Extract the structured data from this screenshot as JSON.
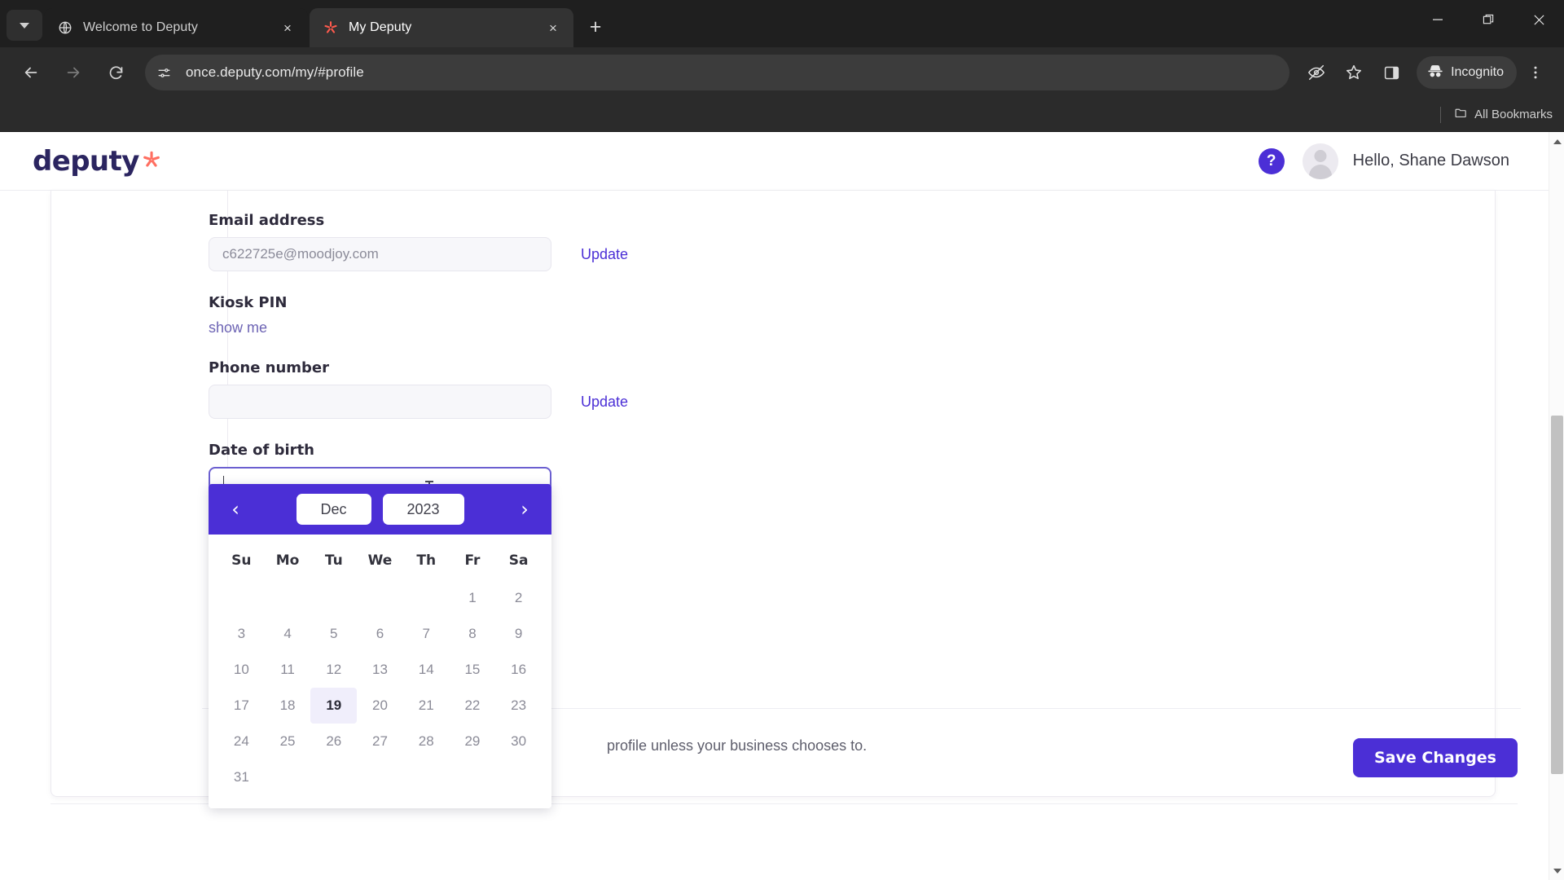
{
  "browser": {
    "tab_search_icon": "chevron-down-icon",
    "tabs": [
      {
        "title": "Welcome to Deputy",
        "favicon": "globe-icon",
        "active": false,
        "close_label": "×"
      },
      {
        "title": "My Deputy",
        "favicon": "deputy-star-icon",
        "active": true,
        "close_label": "×"
      }
    ],
    "new_tab_label": "+",
    "window_controls": {
      "minimize": "–",
      "maximize": "❐",
      "close": "✕"
    },
    "nav": {
      "back": "←",
      "forward": "→",
      "reload": "⟳"
    },
    "omnibox": {
      "url": "once.deputy.com/my/#profile",
      "site_icon": "site-settings-icon"
    },
    "toolbar_icons": [
      "eye-off-icon",
      "star-icon",
      "side-panel-icon",
      "more-vertical-icon"
    ],
    "incognito": {
      "label": "Incognito",
      "icon": "incognito-hat-icon"
    },
    "bookmarks_bar": {
      "all_bookmarks_label": "All Bookmarks",
      "folder_icon": "folder-icon"
    }
  },
  "app": {
    "logo": {
      "text": "deputy",
      "mark": "✳",
      "text_color": "#2b2560",
      "mark_color": "#ff6f61"
    },
    "help_badge": "?",
    "greeting": "Hello, Shane Dawson",
    "avatar_icon": "user-avatar-icon"
  },
  "profile_form": {
    "email": {
      "label": "Email address",
      "value": "c622725e@moodjoy.com",
      "update_label": "Update"
    },
    "kiosk_pin": {
      "label": "Kiosk PIN",
      "show_link": "show me"
    },
    "phone": {
      "label": "Phone number",
      "value": "",
      "placeholder": "",
      "update_label": "Update"
    },
    "dob": {
      "label": "Date of birth",
      "value": "",
      "hint": "profile unless your business chooses to."
    },
    "save_label": "Save Changes"
  },
  "datepicker": {
    "prev_label": "‹",
    "next_label": "›",
    "month": "Dec",
    "year": "2023",
    "weekdays": [
      "Su",
      "Mo",
      "Tu",
      "We",
      "Th",
      "Fr",
      "Sa"
    ],
    "leading_blanks": 5,
    "days": [
      1,
      2,
      3,
      4,
      5,
      6,
      7,
      8,
      9,
      10,
      11,
      12,
      13,
      14,
      15,
      16,
      17,
      18,
      19,
      20,
      21,
      22,
      23,
      24,
      25,
      26,
      27,
      28,
      29,
      30,
      31
    ],
    "today": 19,
    "accent": "#4b2fd6",
    "today_bg": "#f0eefb"
  }
}
